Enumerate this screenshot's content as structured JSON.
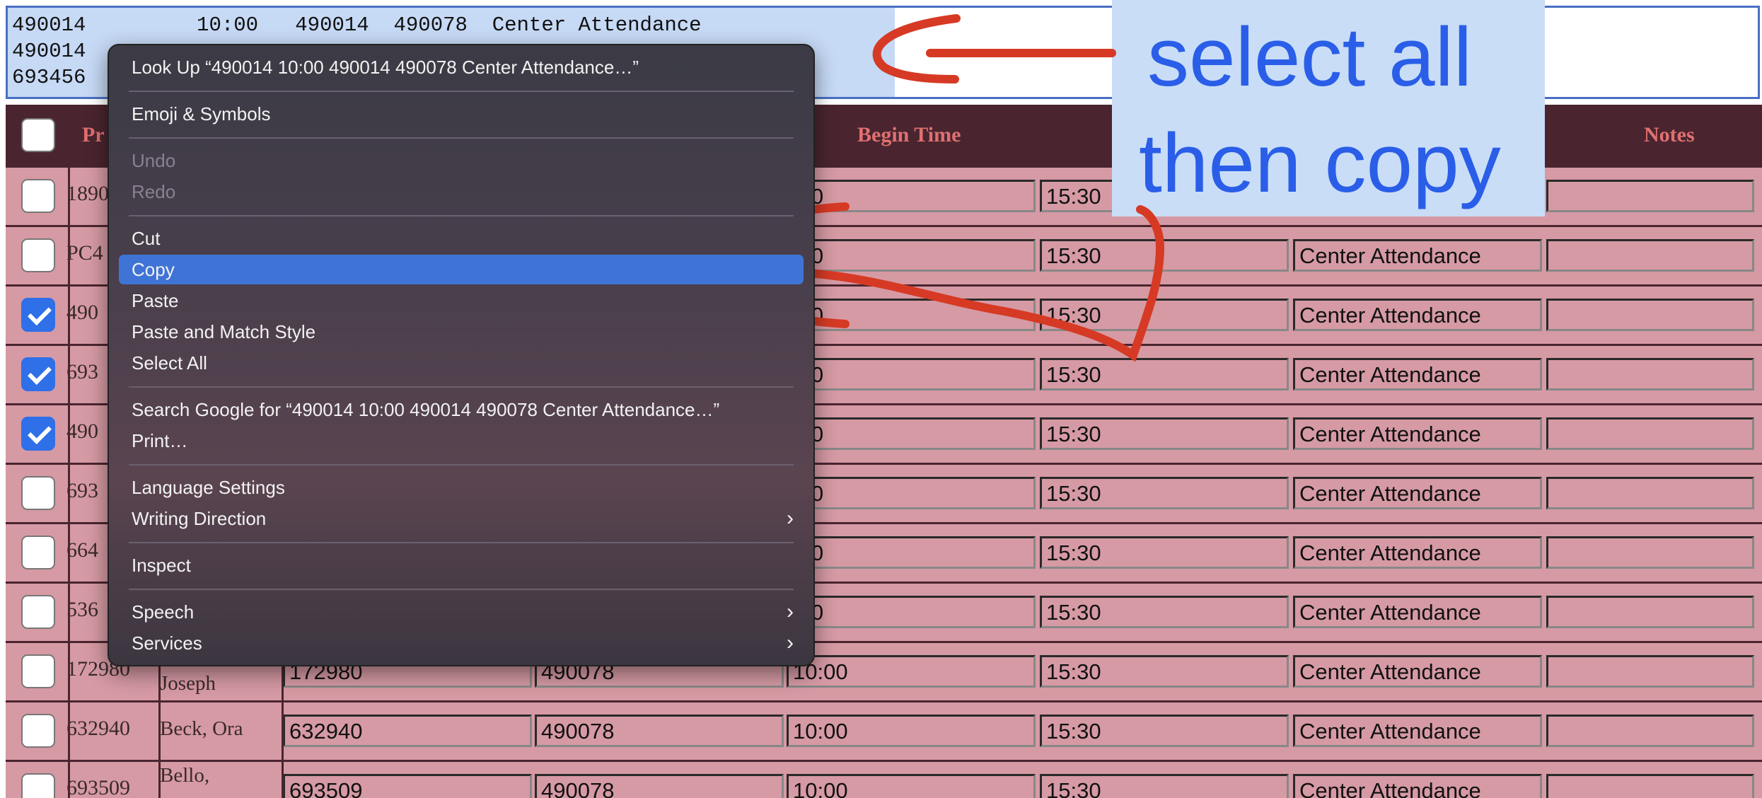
{
  "textarea": {
    "lines": "490014         10:00   490014  490078  Center Attendance\n490014\n693456"
  },
  "table": {
    "headers": {
      "first": "Pr",
      "begin_time": "Begin Time",
      "notes": "Notes"
    },
    "rows": [
      {
        "checked": false,
        "id": "1890",
        "name": "",
        "f1": "",
        "f2": "",
        "begin": ":00",
        "end": "15:30",
        "act": ""
      },
      {
        "checked": false,
        "id": "PC4",
        "name": "",
        "f1": "",
        "f2": "",
        "begin": ":00",
        "end": "15:30",
        "act": "Center Attendance"
      },
      {
        "checked": true,
        "id": "490",
        "name": "",
        "f1": "",
        "f2": "",
        "begin": ":00",
        "end": "15:30",
        "act": "Center Attendance"
      },
      {
        "checked": true,
        "id": "693",
        "name": "",
        "f1": "",
        "f2": "",
        "begin": ":00",
        "end": "15:30",
        "act": "Center Attendance"
      },
      {
        "checked": true,
        "id": "490",
        "name": "",
        "f1": "",
        "f2": "",
        "begin": ":00",
        "end": "15:30",
        "act": "Center Attendance"
      },
      {
        "checked": false,
        "id": "693",
        "name": "",
        "f1": "",
        "f2": "",
        "begin": ":00",
        "end": "15:30",
        "act": "Center Attendance"
      },
      {
        "checked": false,
        "id": "664",
        "name": "",
        "f1": "",
        "f2": "",
        "begin": ":00",
        "end": "15:30",
        "act": "Center Attendance"
      },
      {
        "checked": false,
        "id": "536",
        "name": "",
        "f1": "",
        "f2": "",
        "begin": ":00",
        "end": "15:30",
        "act": "Center Attendance"
      },
      {
        "checked": false,
        "id": "172980",
        "name": "Joseph",
        "f1": "172980",
        "f2": "490078",
        "begin": "10:00",
        "end": "15:30",
        "act": "Center Attendance"
      },
      {
        "checked": false,
        "id": "632940",
        "name": "Beck, Ora",
        "f1": "632940",
        "f2": "490078",
        "begin": "10:00",
        "end": "15:30",
        "act": "Center Attendance"
      },
      {
        "checked": false,
        "id": "693509",
        "name": "Bello,",
        "f1": "693509",
        "f2": "490078",
        "begin": "10:00",
        "end": "15:30",
        "act": "Center Attendance"
      }
    ]
  },
  "menu": {
    "look_up": "Look Up “490014  10:00 490014 490078 Center Attendance…”",
    "emoji": "Emoji & Symbols",
    "undo": "Undo",
    "redo": "Redo",
    "cut": "Cut",
    "copy": "Copy",
    "paste": "Paste",
    "paste_match": "Paste and Match Style",
    "select_all": "Select All",
    "search_google": "Search Google for “490014  10:00 490014 490078 Center Attendance…”",
    "print": "Print…",
    "language": "Language Settings",
    "writing": "Writing Direction",
    "inspect": "Inspect",
    "speech": "Speech",
    "services": "Services"
  },
  "annotation": {
    "line1": "select all",
    "line2": "then copy",
    "color": "#2a5ee8"
  }
}
